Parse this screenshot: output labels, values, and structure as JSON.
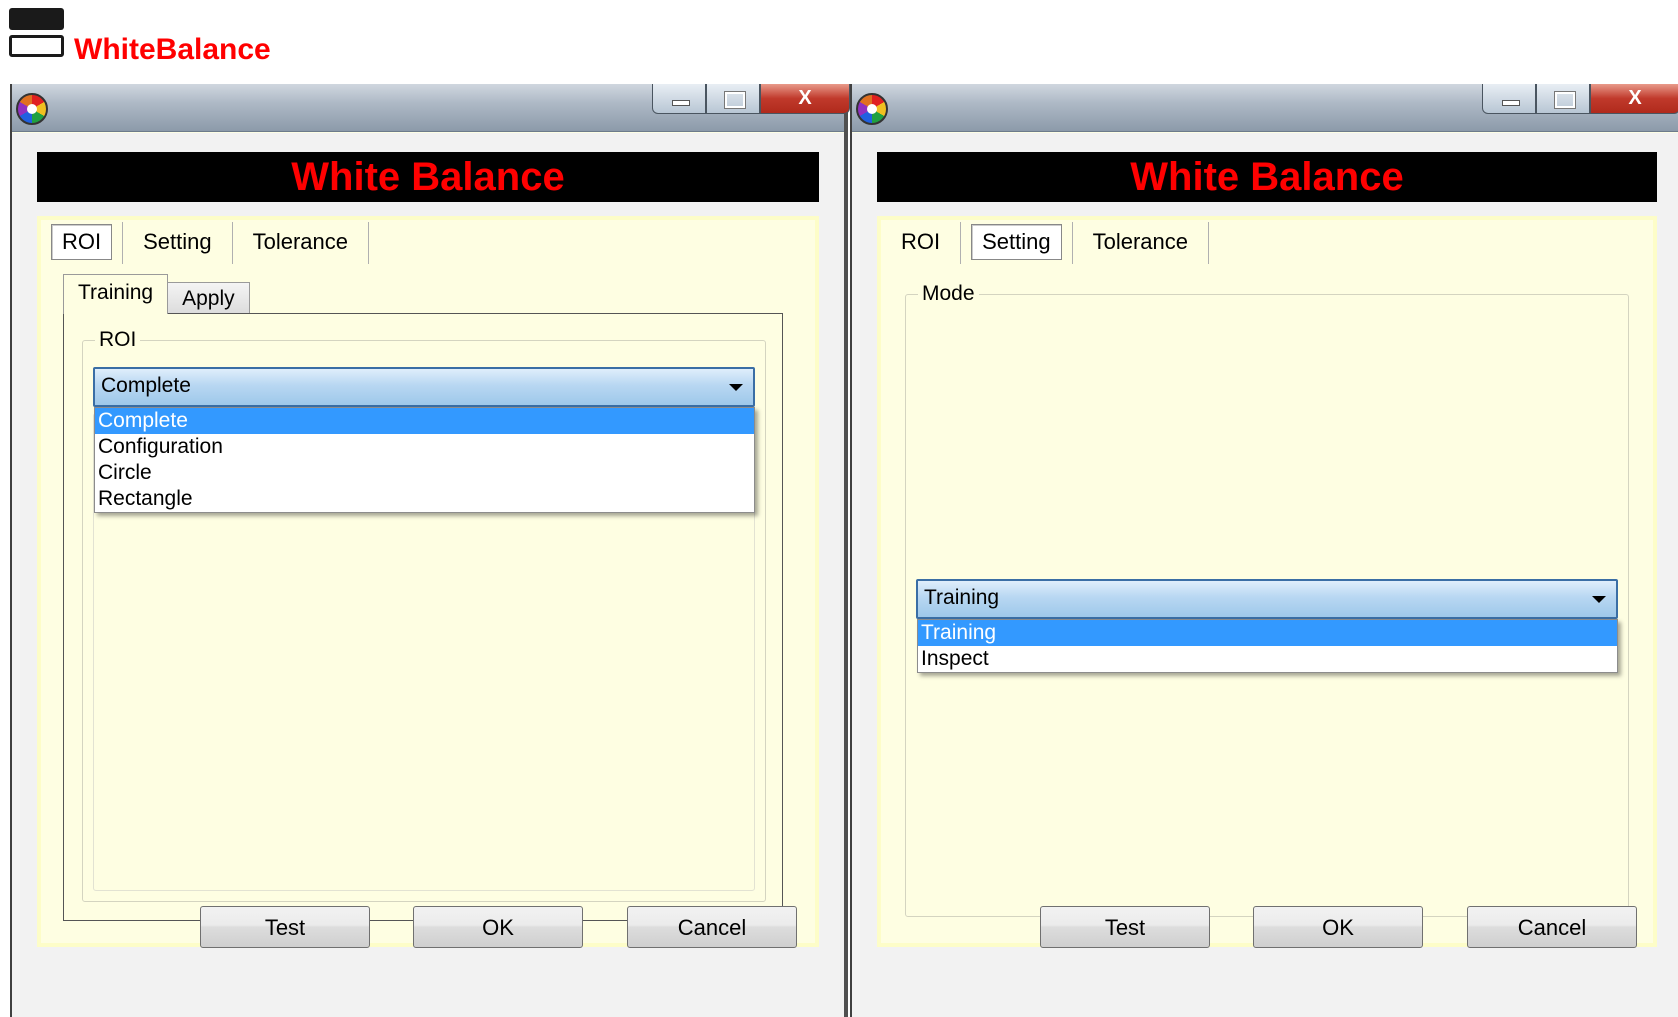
{
  "header": {
    "title": "WhiteBalance",
    "icon": "window-stack-icon",
    "title_color": "#ff0000"
  },
  "windows": [
    {
      "id": "left",
      "banner": "White Balance",
      "caption": {
        "close_label": "X"
      },
      "tabs": [
        {
          "label": "ROI",
          "selected": true
        },
        {
          "label": "Setting",
          "selected": false
        },
        {
          "label": "Tolerance",
          "selected": false
        }
      ],
      "subtabs": [
        {
          "label": "Training",
          "selected": true
        },
        {
          "label": "Apply",
          "selected": false
        }
      ],
      "group_label": "ROI",
      "combo": {
        "value": "Complete",
        "open": true,
        "options": [
          "Complete",
          "Configuration",
          "Circle",
          "Rectangle"
        ],
        "highlighted": "Complete"
      },
      "buttons": {
        "test": "Test",
        "ok": "OK",
        "cancel": "Cancel"
      }
    },
    {
      "id": "right",
      "banner": "White Balance",
      "caption": {
        "close_label": "X"
      },
      "tabs": [
        {
          "label": "ROI",
          "selected": false
        },
        {
          "label": "Setting",
          "selected": true
        },
        {
          "label": "Tolerance",
          "selected": false
        }
      ],
      "group_label": "Mode",
      "combo": {
        "value": "Training",
        "open": true,
        "options": [
          "Training",
          "Inspect"
        ],
        "highlighted": "Training"
      },
      "buttons": {
        "test": "Test",
        "ok": "OK",
        "cancel": "Cancel"
      }
    }
  ],
  "colors": {
    "banner_bg": "#000000",
    "banner_text": "#ff0000",
    "panel_bg": "#fefee2",
    "highlight": "#3399ff"
  }
}
